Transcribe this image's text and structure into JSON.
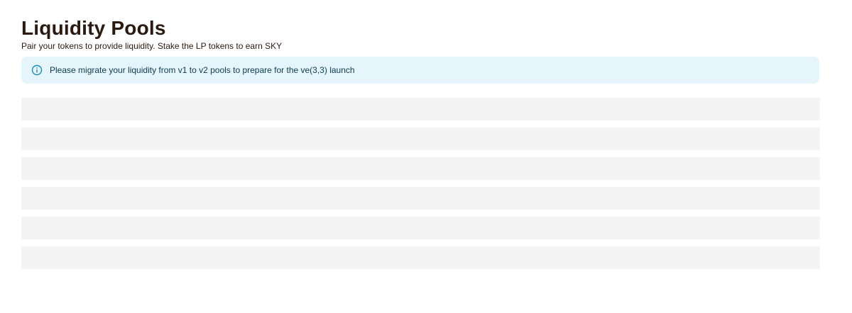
{
  "header": {
    "title": "Liquidity Pools",
    "subtitle": "Pair your tokens to provide liquidity. Stake the LP tokens to earn SKY"
  },
  "alert": {
    "icon": "info-icon",
    "message": "Please migrate your liquidity from v1 to v2 pools to prepare for the ve(3,3) launch",
    "colors": {
      "background": "#e5f5fb",
      "icon": "#1a8fb3",
      "text": "#0b3b4f"
    }
  },
  "skeleton": {
    "row_count": 6,
    "color": "#f4f4f4"
  }
}
